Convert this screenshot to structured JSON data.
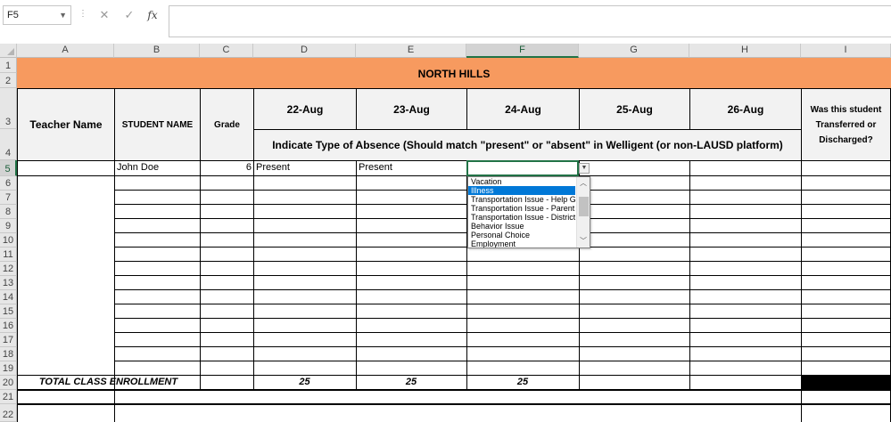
{
  "formula_bar": {
    "name_box": "F5",
    "cancel_icon": "✕",
    "enter_icon": "✓",
    "fx_icon": "fx",
    "formula_value": ""
  },
  "columns": [
    "A",
    "B",
    "C",
    "D",
    "E",
    "F",
    "G",
    "H",
    "I"
  ],
  "rows": [
    "1",
    "2",
    "3",
    "4",
    "5",
    "6",
    "7",
    "8",
    "9",
    "10",
    "11",
    "12",
    "13",
    "14",
    "15",
    "16",
    "17",
    "18",
    "19",
    "20",
    "21",
    "22"
  ],
  "sheet": {
    "title": "NORTH HILLS",
    "teacher_name": "Teacher Name",
    "student_name": "STUDENT NAME",
    "grade": "Grade",
    "dates": [
      "22-Aug",
      "23-Aug",
      "24-Aug",
      "25-Aug",
      "26-Aug"
    ],
    "instruction": "Indicate Type of Absence (Should match \"present\" or \"absent\" in Welligent (or non-LAUSD platform)",
    "transferred": "Was this student Transferred or Discharged?",
    "row5": {
      "student": "John Doe",
      "grade": "6",
      "d1": "Present",
      "d2": "Present"
    },
    "total_label": "TOTAL CLASS ENROLLMENT",
    "totals": [
      "25",
      "25",
      "25"
    ]
  },
  "dropdown": {
    "items": [
      "Vacation",
      "Illness",
      "Transportation Issue - Help Gr",
      "Transportation Issue - Parent",
      "Transportation Issue - District",
      "Behavior Issue",
      "Personal Choice",
      "Employment"
    ],
    "highlighted": "Illness",
    "highlight_color": "#0078d7"
  },
  "colors": {
    "header_fill": "#f79a5f",
    "selection_accent": "#217346"
  }
}
